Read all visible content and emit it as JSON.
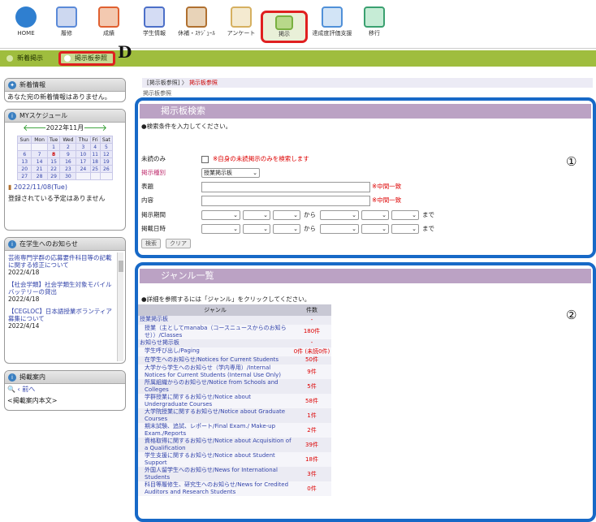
{
  "toolbar": {
    "items": [
      {
        "label": "HOME",
        "color": "#2f7fd0"
      },
      {
        "label": "履修",
        "color": "#5b8ad8"
      },
      {
        "label": "成績",
        "color": "#e06030"
      },
      {
        "label": "学生情報",
        "color": "#4c6fc8"
      },
      {
        "label": "休補・ｽｹｼﾞｭｰﾙ",
        "color": "#b07030"
      },
      {
        "label": "アンケート",
        "color": "#d6b060"
      },
      {
        "label": "掲示",
        "color": "#78b040"
      },
      {
        "label": "達成度評価支援",
        "color": "#5090d8"
      },
      {
        "label": "移行",
        "color": "#3aa070"
      }
    ]
  },
  "subbar": {
    "new": "新着掲示",
    "board": "掲示板参照"
  },
  "marker_d": "D",
  "sidebar": {
    "news_title": "新着情報",
    "news_body": "あなた宛の新着情報はありません。",
    "sched_title": "MYスケジュール",
    "cal_month": "2022年11月",
    "cal_days": [
      "Sun",
      "Mon",
      "Tue",
      "Wed",
      "Thu",
      "Fri",
      "Sat"
    ],
    "cal_today": "2022/11/08(Tue)",
    "cal_empty": "登録されている予定はありません",
    "notice_title": "在学生へのお知らせ",
    "notices": [
      {
        "text": "芸術専門学群の応募要件科目等の記載に関する修正について",
        "date": "2022/4/18"
      },
      {
        "text": "【社会学類】社会学類生対象モバイルバッテリーの貸出",
        "date": "2022/4/18"
      },
      {
        "text": "【CEGLOC】日本語授業ボランティア募集について",
        "date": "2022/4/14"
      }
    ],
    "guide_title": "掲載案内",
    "guide_prev": "前へ",
    "guide_body": "<掲載案内本文>"
  },
  "breadcrumb": {
    "parent": "[掲示板参照]",
    "sep": "〉",
    "current": "掲示板参照",
    "sub": "掲示板参照"
  },
  "search": {
    "title": "掲示板検索",
    "instruction": "●検索条件を入力してください。",
    "unread_label": "未読のみ",
    "unread_note": "※自身の未読掲示のみを検索します",
    "type_label": "掲示種別",
    "type_value": "授業掲示板",
    "subject_label": "表題",
    "content_label": "内容",
    "partial_match": "※中間一致",
    "period_label": "掲示期間",
    "posted_label": "掲載日時",
    "from": "から",
    "to": "まで",
    "search_btn": "検索",
    "clear_btn": "クリア",
    "marker": "①"
  },
  "genre": {
    "title": "ジャンル一覧",
    "instruction": "●詳細を参照するには「ジャンル」をクリックしてください。",
    "col_genre": "ジャンル",
    "col_count": "件数",
    "marker": "②",
    "rows": [
      {
        "name": "授業掲示板",
        "count": "-",
        "indent": false
      },
      {
        "name": "授業（主としてmanaba（コースニュースからのお知らせ））/Classes",
        "count": "180件",
        "indent": true
      },
      {
        "name": "お知らせ掲示板",
        "count": "-",
        "indent": false
      },
      {
        "name": "学生呼び出し/Paging",
        "count": "0件 (未読0件)",
        "indent": true
      },
      {
        "name": "在学生へのお知らせ/Notices for Current Students",
        "count": "50件",
        "indent": true
      },
      {
        "name": "大学から学生へのお知らせ（学内専用）/Internal Notices for Current Students (Internal Use Only)",
        "count": "9件",
        "indent": true
      },
      {
        "name": "所属組織からのお知らせ/Notice from Schools and Colleges",
        "count": "5件",
        "indent": true
      },
      {
        "name": "学群授業に関するお知らせ/Notice about Undergraduate Courses",
        "count": "58件",
        "indent": true
      },
      {
        "name": "大学院授業に関するお知らせ/Notice about Graduate Courses",
        "count": "1件",
        "indent": true
      },
      {
        "name": "期末試験、追試、レポート/Final Exam./ Make-up Exam./Reports",
        "count": "2件",
        "indent": true
      },
      {
        "name": "資格取得に関するお知らせ/Notice about Acquisition of a Qualification",
        "count": "39件",
        "indent": true
      },
      {
        "name": "学生支援に関するお知らせ/Notice about Student Support",
        "count": "18件",
        "indent": true
      },
      {
        "name": "外国人留学生へのお知らせ/News for International Students",
        "count": "3件",
        "indent": true
      },
      {
        "name": "科目等履修生、研究生へのお知らせ/News for Credited Auditors and Research Students",
        "count": "0件",
        "indent": true
      }
    ]
  }
}
